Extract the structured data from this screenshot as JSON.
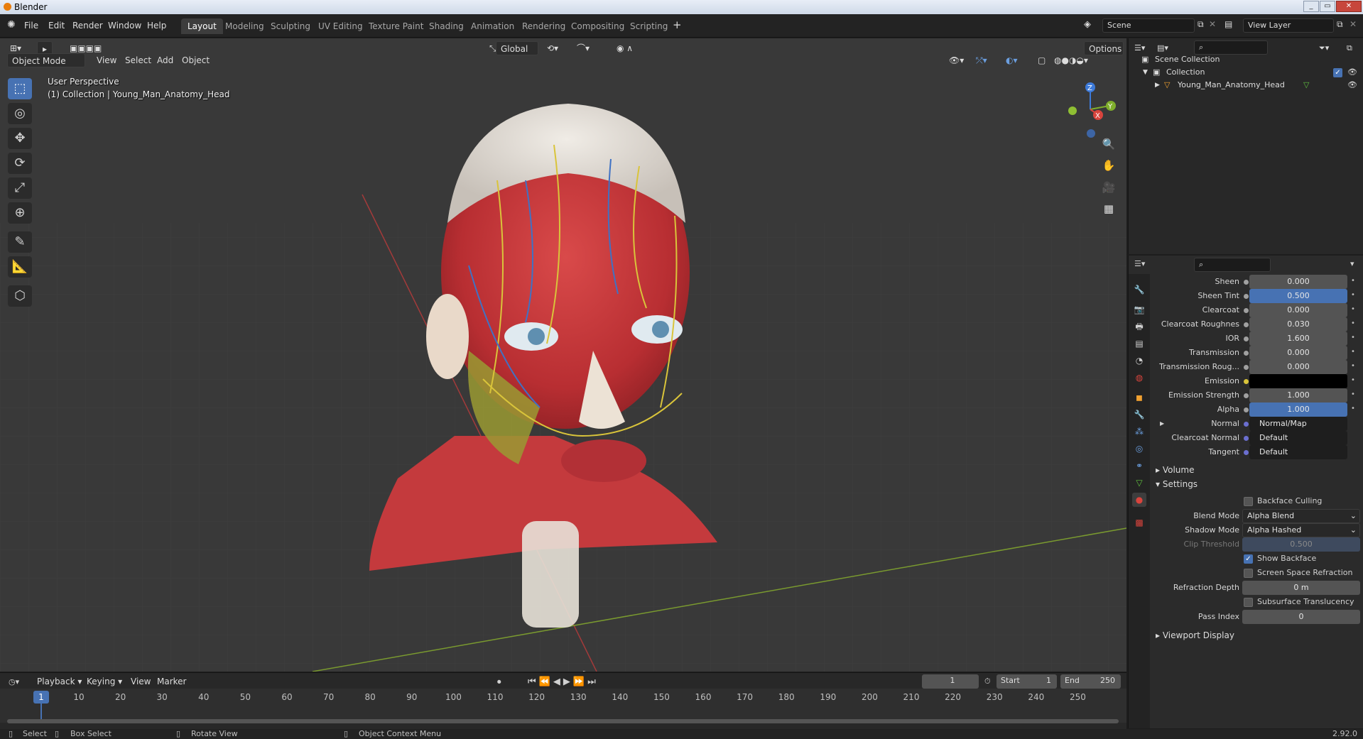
{
  "titlebar": {
    "title": "Blender"
  },
  "menu": [
    "File",
    "Edit",
    "Render",
    "Window",
    "Help"
  ],
  "workspaces": [
    {
      "label": "Layout",
      "active": true
    },
    {
      "label": "Modeling"
    },
    {
      "label": "Sculpting"
    },
    {
      "label": "UV Editing"
    },
    {
      "label": "Texture Paint"
    },
    {
      "label": "Shading"
    },
    {
      "label": "Animation"
    },
    {
      "label": "Rendering"
    },
    {
      "label": "Compositing"
    },
    {
      "label": "Scripting"
    }
  ],
  "add_workspace": "+",
  "scene": {
    "label": "Scene"
  },
  "view_layer": {
    "label": "View Layer"
  },
  "viewport": {
    "mode": "Object Mode",
    "menus": [
      "View",
      "Select",
      "Add",
      "Object"
    ],
    "orientation": "Global",
    "options": "Options",
    "perspective": "User Perspective",
    "collection_info": "(1) Collection | Young_Man_Anatomy_Head",
    "gizmo": {
      "x": "X",
      "y": "Y",
      "z": "Z"
    }
  },
  "outliner": {
    "scene_collection": "Scene Collection",
    "collection": "Collection",
    "object": "Young_Man_Anatomy_Head"
  },
  "properties": {
    "rows": [
      {
        "label": "Sheen",
        "value": "0.000",
        "style": "grey"
      },
      {
        "label": "Sheen Tint",
        "value": "0.500",
        "style": "blue"
      },
      {
        "label": "Clearcoat",
        "value": "0.000",
        "style": "grey"
      },
      {
        "label": "Clearcoat Roughnes",
        "value": "0.030",
        "style": "grey"
      },
      {
        "label": "IOR",
        "value": "1.600",
        "style": "grey"
      },
      {
        "label": "Transmission",
        "value": "0.000",
        "style": "grey"
      },
      {
        "label": "Transmission Roug...",
        "value": "0.000",
        "style": "grey"
      },
      {
        "label": "Emission",
        "value": "",
        "style": "black"
      },
      {
        "label": "Emission Strength",
        "value": "1.000",
        "style": "grey"
      },
      {
        "label": "Alpha",
        "value": "1.000",
        "style": "blue"
      },
      {
        "label": "Normal",
        "value": "Normal/Map",
        "style": "dark"
      },
      {
        "label": "Clearcoat Normal",
        "value": "Default",
        "style": "dark"
      },
      {
        "label": "Tangent",
        "value": "Default",
        "style": "dark"
      }
    ],
    "sections": {
      "volume": "Volume",
      "settings": "Settings",
      "viewport_display": "Viewport Display"
    },
    "settings": {
      "backface_culling": "Backface Culling",
      "blend_mode_label": "Blend Mode",
      "blend_mode": "Alpha Blend",
      "shadow_mode_label": "Shadow Mode",
      "shadow_mode": "Alpha Hashed",
      "clip_threshold_label": "Clip Threshold",
      "clip_threshold": "0.500",
      "show_backface": "Show Backface",
      "ssr": "Screen Space Refraction",
      "refraction_depth_label": "Refraction Depth",
      "refraction_depth": "0 m",
      "subsurface": "Subsurface Translucency",
      "pass_index_label": "Pass Index",
      "pass_index": "0"
    },
    "version": "2.92.0"
  },
  "timeline": {
    "menus": [
      "Playback",
      "Keying",
      "View",
      "Marker"
    ],
    "current_frame": "1",
    "start_label": "Start",
    "start": "1",
    "end_label": "End",
    "end": "250",
    "ticks": [
      "1",
      "10",
      "20",
      "30",
      "40",
      "50",
      "60",
      "70",
      "80",
      "90",
      "100",
      "110",
      "120",
      "130",
      "140",
      "150",
      "160",
      "170",
      "180",
      "190",
      "200",
      "210",
      "220",
      "230",
      "240",
      "250"
    ]
  },
  "status": {
    "select": "Select",
    "box_select": "Box Select",
    "rotate_view": "Rotate View",
    "context_menu": "Object Context Menu"
  }
}
